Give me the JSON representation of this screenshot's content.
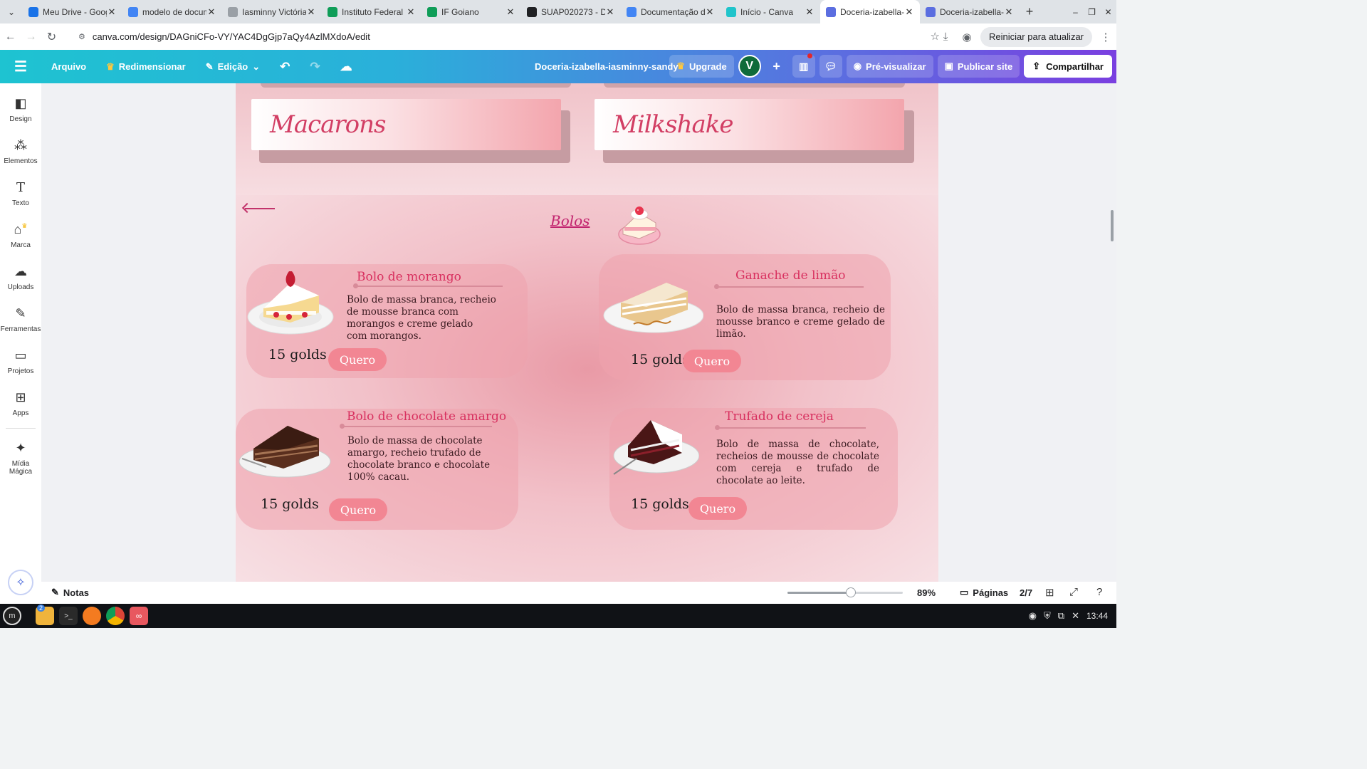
{
  "browser": {
    "tabs": [
      {
        "title": "Meu Drive - Goog",
        "favicon_color": "#1a73e8",
        "active": false
      },
      {
        "title": "modelo de docum",
        "favicon_color": "#4285f4",
        "active": false
      },
      {
        "title": "Iasminny Victória",
        "favicon_color": "#9aa0a6",
        "active": false
      },
      {
        "title": "Instituto Federal",
        "favicon_color": "#0f9d58",
        "active": false
      },
      {
        "title": "IF Goiano",
        "favicon_color": "#0f9d58",
        "active": false
      },
      {
        "title": "SUAP020273 - De",
        "favicon_color": "#202124",
        "active": false
      },
      {
        "title": "Documentação d",
        "favicon_color": "#4285f4",
        "active": false
      },
      {
        "title": "Início - Canva",
        "favicon_color": "#20c4cb",
        "active": false
      },
      {
        "title": "Doceria-izabella-",
        "favicon_color": "#5b6ee0",
        "active": true
      },
      {
        "title": "Doceria-izabella-",
        "favicon_color": "#5b6ee0",
        "active": false
      }
    ],
    "url": "canva.com/design/DAGniCFo-VY/YAC4DgGjp7aQy4AzlMXdoA/edit",
    "update_button": "Reiniciar para atualizar"
  },
  "canva": {
    "menu": {
      "file": "Arquivo",
      "resize": "Redimensionar",
      "edit": "Edição"
    },
    "doc_title": "Doceria-izabella-iasminny-sandy",
    "upgrade": "Upgrade",
    "avatar_initial": "V",
    "preview": "Pré-visualizar",
    "publish": "Publicar site",
    "share": "Compartilhar",
    "rail": [
      {
        "label": "Design",
        "icon": "layout-icon"
      },
      {
        "label": "Elementos",
        "icon": "shapes-icon"
      },
      {
        "label": "Texto",
        "icon": "text-icon"
      },
      {
        "label": "Marca",
        "icon": "brand-icon"
      },
      {
        "label": "Uploads",
        "icon": "cloud-upload-icon"
      },
      {
        "label": "Ferramentas",
        "icon": "pen-icon"
      },
      {
        "label": "Projetos",
        "icon": "folder-icon"
      },
      {
        "label": "Apps",
        "icon": "apps-icon"
      },
      {
        "label": "Mídia Mágica",
        "icon": "magic-media-icon"
      }
    ],
    "bottom": {
      "notes": "Notas",
      "zoom": "89%",
      "zoom_fraction": 0.55,
      "pages_label": "Páginas",
      "page_indicator": "2/7"
    }
  },
  "design": {
    "top_banners": [
      "Macarons",
      "Milkshake"
    ],
    "section_title": "Bolos",
    "products": [
      {
        "name": "Bolo de morango",
        "description": "Bolo de massa branca, recheio de mousse branca com morangos e creme gelado com morangos.",
        "price": "15 golds",
        "button": "Quero"
      },
      {
        "name": "Ganache de limão",
        "description": "Bolo de massa branca, recheio de mousse branco e creme gelado de limão.",
        "price": "15 golds",
        "button": "Quero"
      },
      {
        "name": "Bolo de chocolate amargo",
        "description": "Bolo de massa de chocolate amargo, recheio trufado de chocolate branco e chocolate 100% cacau.",
        "price": "15 golds",
        "button": "Quero"
      },
      {
        "name": "Trufado de cereja",
        "description": "Bolo de massa de chocolate, recheios de mousse de chocolate com cereja e trufado de chocolate ao leite.",
        "price": "15 golds",
        "button": "Quero"
      }
    ]
  },
  "taskbar": {
    "time": "13:44",
    "files_badge": "2"
  }
}
